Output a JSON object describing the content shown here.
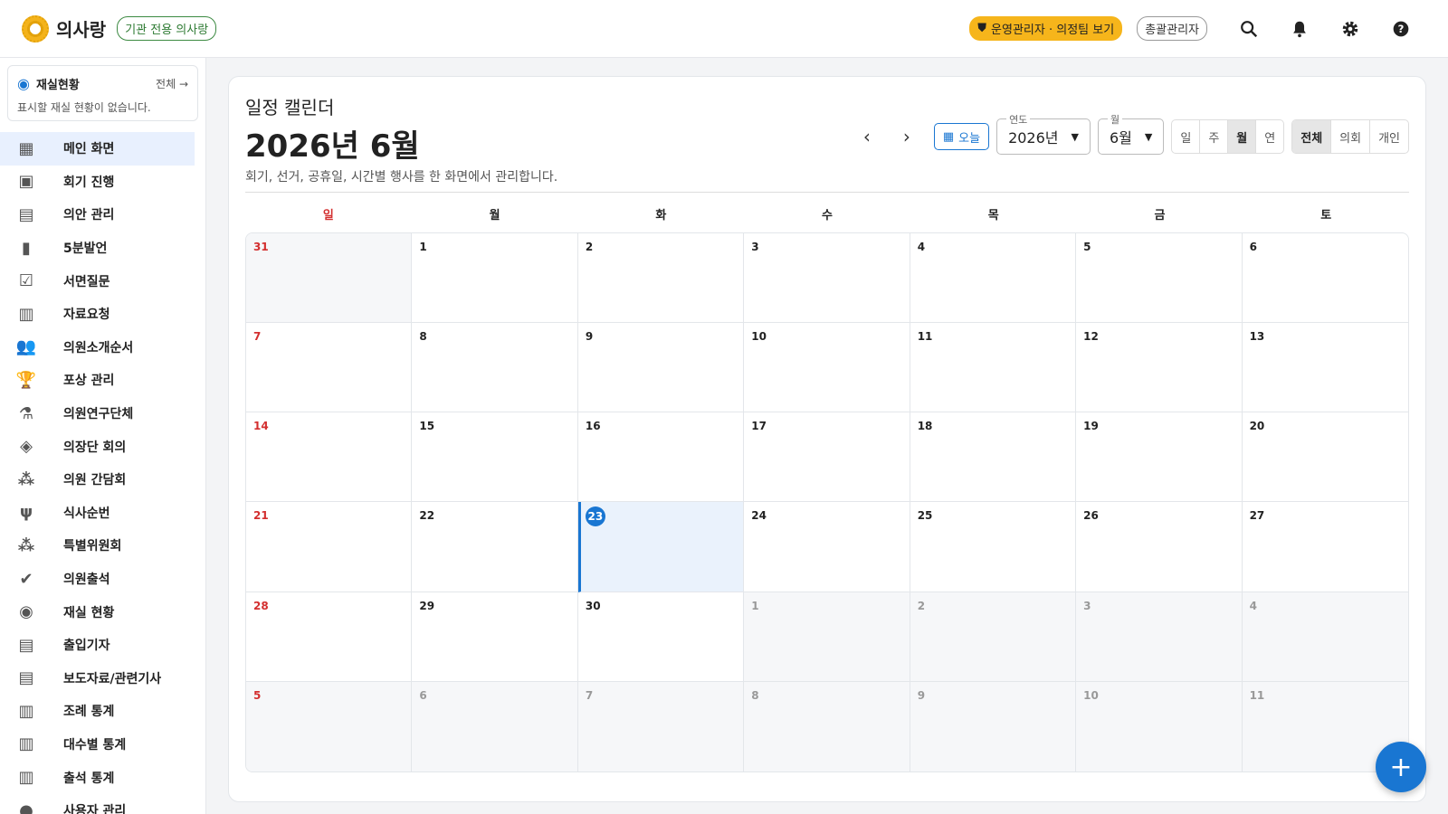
{
  "header": {
    "app_name": "의사랑",
    "org_badge": "기관 전용 의사랑",
    "ops_badge": "운영관리자 · 의정팀 보기",
    "role_badge": "총괄관리자",
    "icons": [
      "search-icon",
      "bell-icon",
      "gear-icon",
      "help-icon"
    ]
  },
  "sidebar": {
    "room_card": {
      "title": "재실현황",
      "all_link": "전체 →",
      "empty_text": "표시할 재실 현황이 없습니다."
    },
    "items": [
      {
        "label": "메인 화면",
        "icon": "dashboard-icon",
        "active": true
      },
      {
        "label": "회기 진행",
        "icon": "calendar-icon"
      },
      {
        "label": "의안 관리",
        "icon": "clipboard-icon"
      },
      {
        "label": "5분발언",
        "icon": "document-icon"
      },
      {
        "label": "서면질문",
        "icon": "checklist-icon"
      },
      {
        "label": "자료요청",
        "icon": "book-icon"
      },
      {
        "label": "의원소개순서",
        "icon": "people-icon"
      },
      {
        "label": "포상 관리",
        "icon": "trophy-icon"
      },
      {
        "label": "의원연구단체",
        "icon": "microscope-icon"
      },
      {
        "label": "의장단 회의",
        "icon": "handshake-icon"
      },
      {
        "label": "의원 간담회",
        "icon": "groups-icon"
      },
      {
        "label": "식사순번",
        "icon": "utensils-icon"
      },
      {
        "label": "특별위원회",
        "icon": "groups-icon"
      },
      {
        "label": "의원출석",
        "icon": "person-check-icon"
      },
      {
        "label": "재실 현황",
        "icon": "person-pin-icon"
      },
      {
        "label": "출입기자",
        "icon": "table-icon"
      },
      {
        "label": "보도자료/관련기사",
        "icon": "table-icon"
      },
      {
        "label": "조례 통계",
        "icon": "bar-chart-icon"
      },
      {
        "label": "대수별 통계",
        "icon": "bar-chart-icon"
      },
      {
        "label": "출석 통계",
        "icon": "bar-chart-icon"
      },
      {
        "label": "사용자 관리",
        "icon": "person-icon"
      }
    ]
  },
  "calendar": {
    "subtitle": "일정 캘린더",
    "title": "2026년 6월",
    "description": "회기, 선거, 공휴일, 시간별 행사를 한 화면에서 관리합니다.",
    "today_label": "오늘",
    "year_label": "연도",
    "year_value": "2026년",
    "month_label": "월",
    "month_value": "6월",
    "view_modes": [
      {
        "label": "일"
      },
      {
        "label": "주"
      },
      {
        "label": "월",
        "active": true
      },
      {
        "label": "연"
      }
    ],
    "filters": [
      {
        "label": "전체",
        "active": true
      },
      {
        "label": "의회"
      },
      {
        "label": "개인"
      }
    ],
    "weekdays": [
      "일",
      "월",
      "화",
      "수",
      "목",
      "금",
      "토"
    ],
    "days": [
      {
        "d": "31",
        "out": true
      },
      {
        "d": "1"
      },
      {
        "d": "2"
      },
      {
        "d": "3"
      },
      {
        "d": "4"
      },
      {
        "d": "5"
      },
      {
        "d": "6"
      },
      {
        "d": "7"
      },
      {
        "d": "8"
      },
      {
        "d": "9"
      },
      {
        "d": "10"
      },
      {
        "d": "11"
      },
      {
        "d": "12"
      },
      {
        "d": "13"
      },
      {
        "d": "14"
      },
      {
        "d": "15"
      },
      {
        "d": "16"
      },
      {
        "d": "17"
      },
      {
        "d": "18"
      },
      {
        "d": "19"
      },
      {
        "d": "20"
      },
      {
        "d": "21"
      },
      {
        "d": "22"
      },
      {
        "d": "23",
        "today": true
      },
      {
        "d": "24"
      },
      {
        "d": "25"
      },
      {
        "d": "26"
      },
      {
        "d": "27"
      },
      {
        "d": "28"
      },
      {
        "d": "29"
      },
      {
        "d": "30"
      },
      {
        "d": "1",
        "out": true
      },
      {
        "d": "2",
        "out": true
      },
      {
        "d": "3",
        "out": true
      },
      {
        "d": "4",
        "out": true
      },
      {
        "d": "5",
        "out": true
      },
      {
        "d": "6",
        "out": true
      },
      {
        "d": "7",
        "out": true
      },
      {
        "d": "8",
        "out": true
      },
      {
        "d": "9",
        "out": true
      },
      {
        "d": "10",
        "out": true
      },
      {
        "d": "11",
        "out": true
      }
    ]
  },
  "colors": {
    "accent": "#1976d2",
    "sunday": "#d32f2f",
    "ops_badge": "#f6b51b",
    "org_badge": "#2d7a32"
  }
}
